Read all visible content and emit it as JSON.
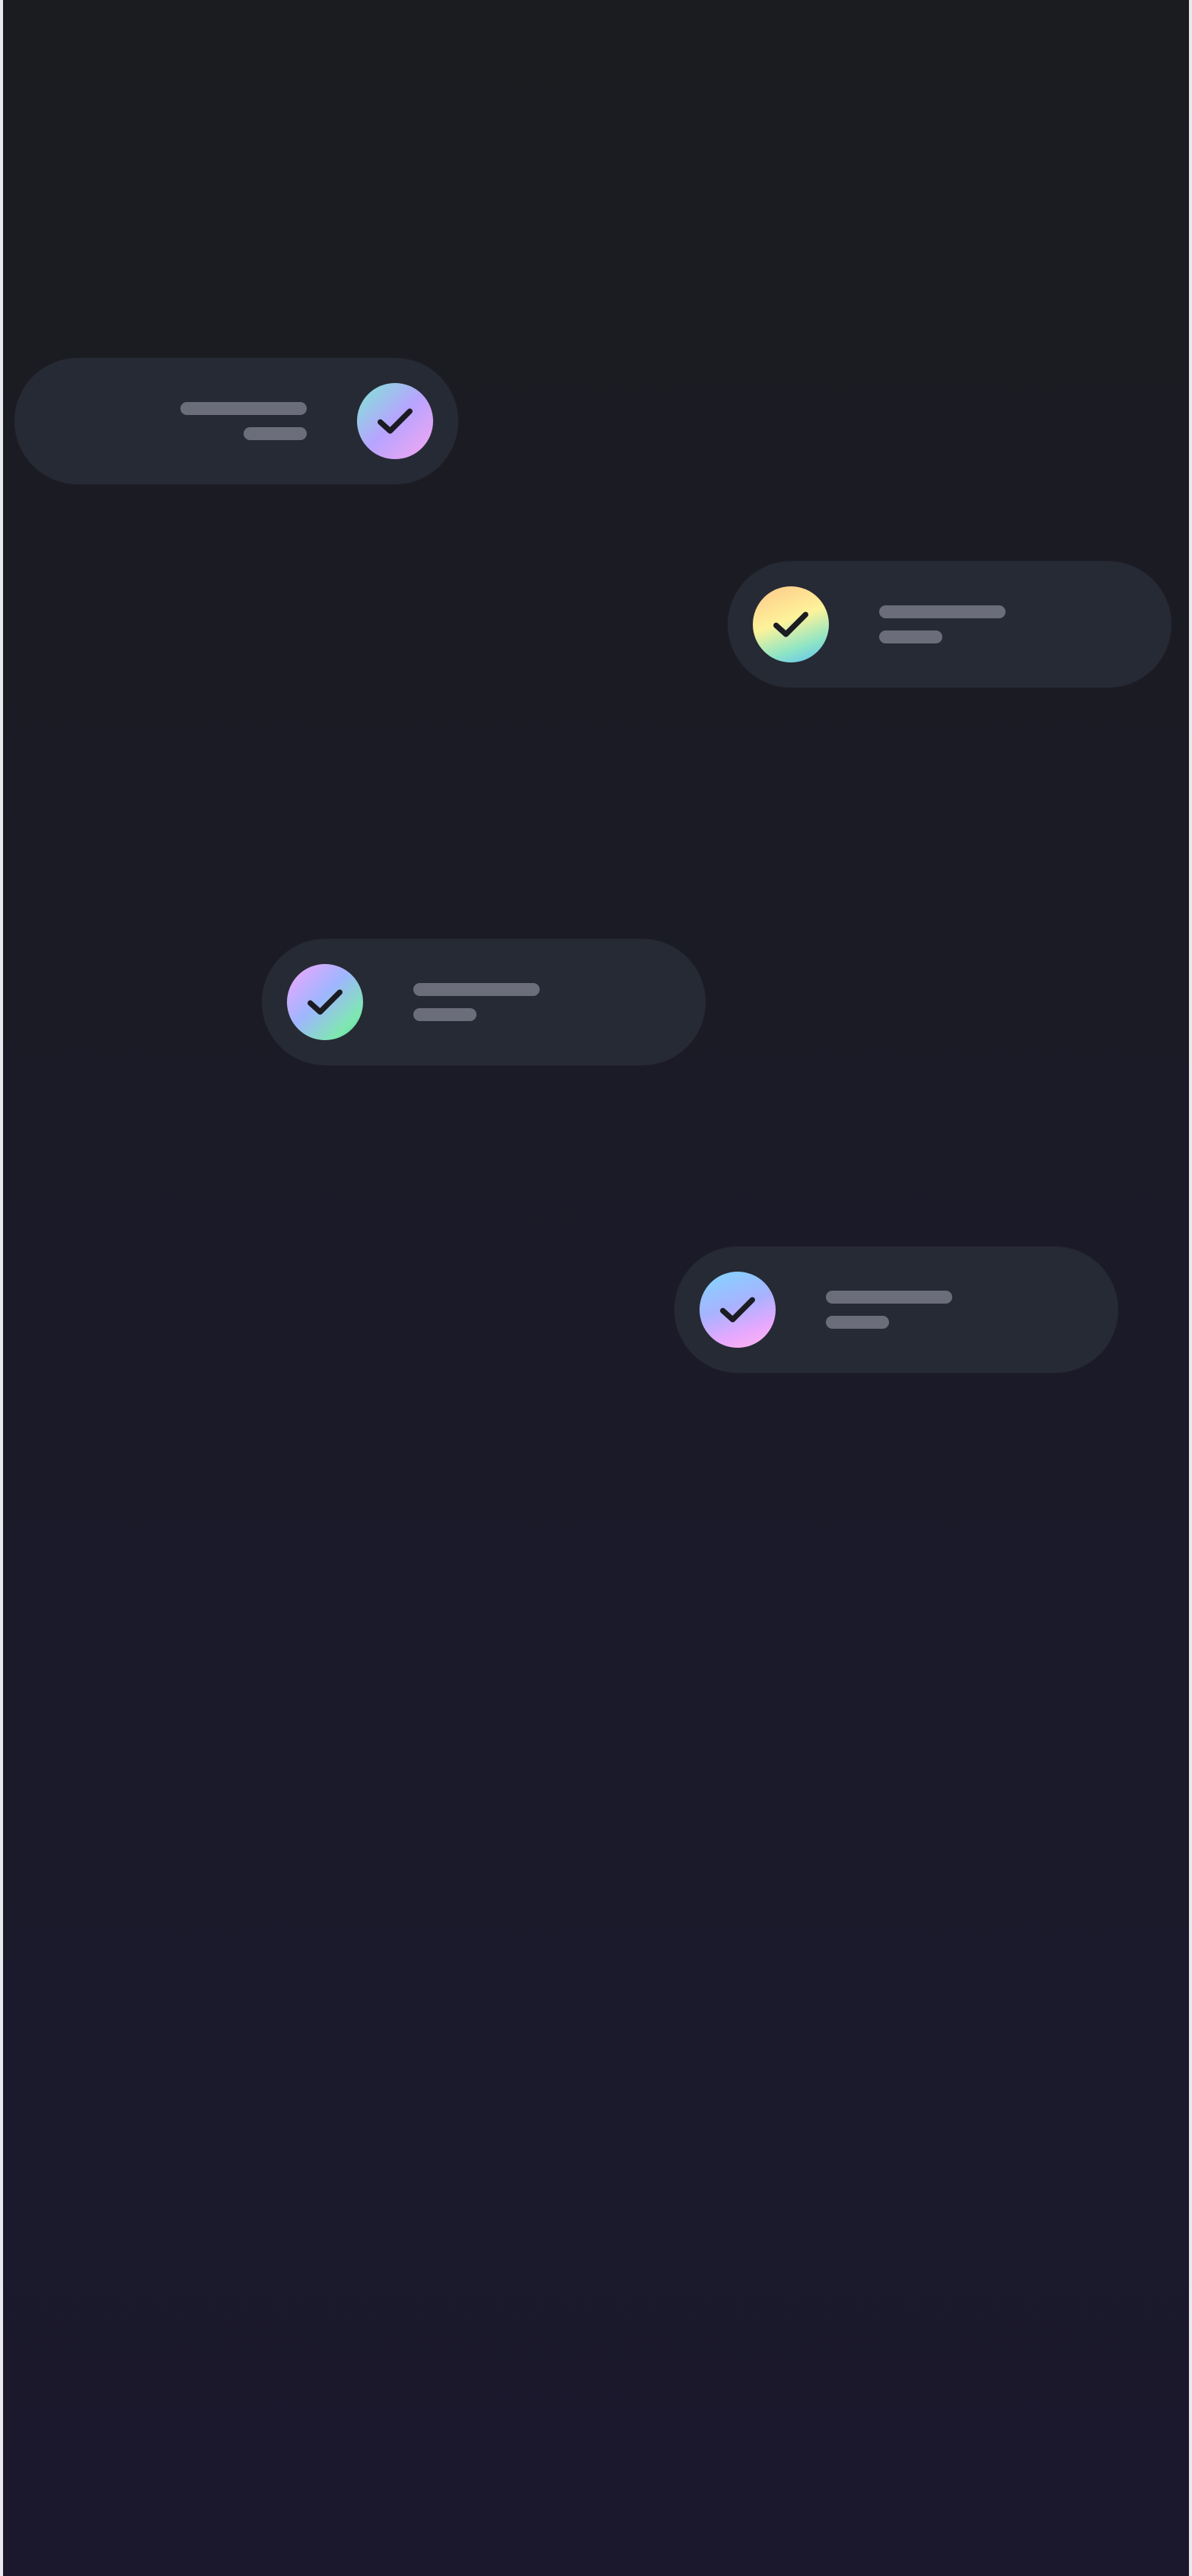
{
  "screen": {
    "background_top": "#1b1c20",
    "background_bottom": "#1b182d"
  },
  "notifications": [
    {
      "id": 1,
      "icon": "check-icon",
      "status": "completed",
      "text_placeholder_lines": 2,
      "alignment": "right",
      "badge_colors": [
        "#7ee8d4",
        "#b7a4ff",
        "#f7a6f0"
      ]
    },
    {
      "id": 2,
      "icon": "check-icon",
      "status": "completed",
      "text_placeholder_lines": 2,
      "alignment": "left",
      "badge_colors": [
        "#ffc78a",
        "#fdf39a",
        "#8fe5c4",
        "#5dbff5"
      ]
    },
    {
      "id": 3,
      "icon": "check-icon",
      "status": "completed",
      "text_placeholder_lines": 2,
      "alignment": "left",
      "badge_colors": [
        "#f4a4ff",
        "#9fb6ff",
        "#7ee8b0",
        "#50d4a2"
      ]
    },
    {
      "id": 4,
      "icon": "check-icon",
      "status": "completed",
      "text_placeholder_lines": 2,
      "alignment": "left",
      "badge_colors": [
        "#7fd8ff",
        "#a8b2ff",
        "#e8a8ff",
        "#ffb8e8"
      ]
    }
  ],
  "colors": {
    "pill_background": "#262a34",
    "placeholder_line": "#6b6e7a",
    "checkmark": "#1b1b22"
  }
}
